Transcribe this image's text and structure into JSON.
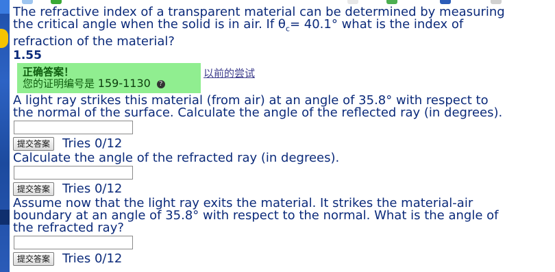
{
  "question1": {
    "line1": "The refractive index of a transparent material can be determined by measuring",
    "line2_part1": "the critical angle when the solid is in air. If θ",
    "line2_sub": "c",
    "line2_part2": "= 40.1° what is the index of",
    "line3": "refraction of the material?",
    "answer": "1.55"
  },
  "correct_panel": {
    "title": "正确答案！",
    "proof_label": "您的证明编号是",
    "proof_number": "159-1130",
    "help_icon_glyph": "?",
    "prev_attempts_link": "以前的尝试"
  },
  "question2": {
    "line1": "A light ray strikes this material (from air) at an angle of 35.8° with respect to",
    "line2": "the normal of the surface. Calculate the angle of the reflected ray (in degrees).",
    "submit_label": "提交答案",
    "tries": "Tries 0/12",
    "input_value": ""
  },
  "question3": {
    "line1": "Calculate the angle of the refracted ray (in degrees).",
    "submit_label": "提交答案",
    "tries": "Tries 0/12",
    "input_value": ""
  },
  "question4": {
    "line1": "Assume now that the light ray exits the material. It strikes the material-air",
    "line2": "boundary at an angle of 35.8° with respect to the normal. What is the angle of",
    "line3": "the refracted ray?",
    "submit_label": "提交答案",
    "tries": "Tries 0/12",
    "input_value": ""
  },
  "colors": {
    "text": "#0b2a7a",
    "correct_bg": "#90ee90",
    "correct_text": "#0d5c0d"
  }
}
